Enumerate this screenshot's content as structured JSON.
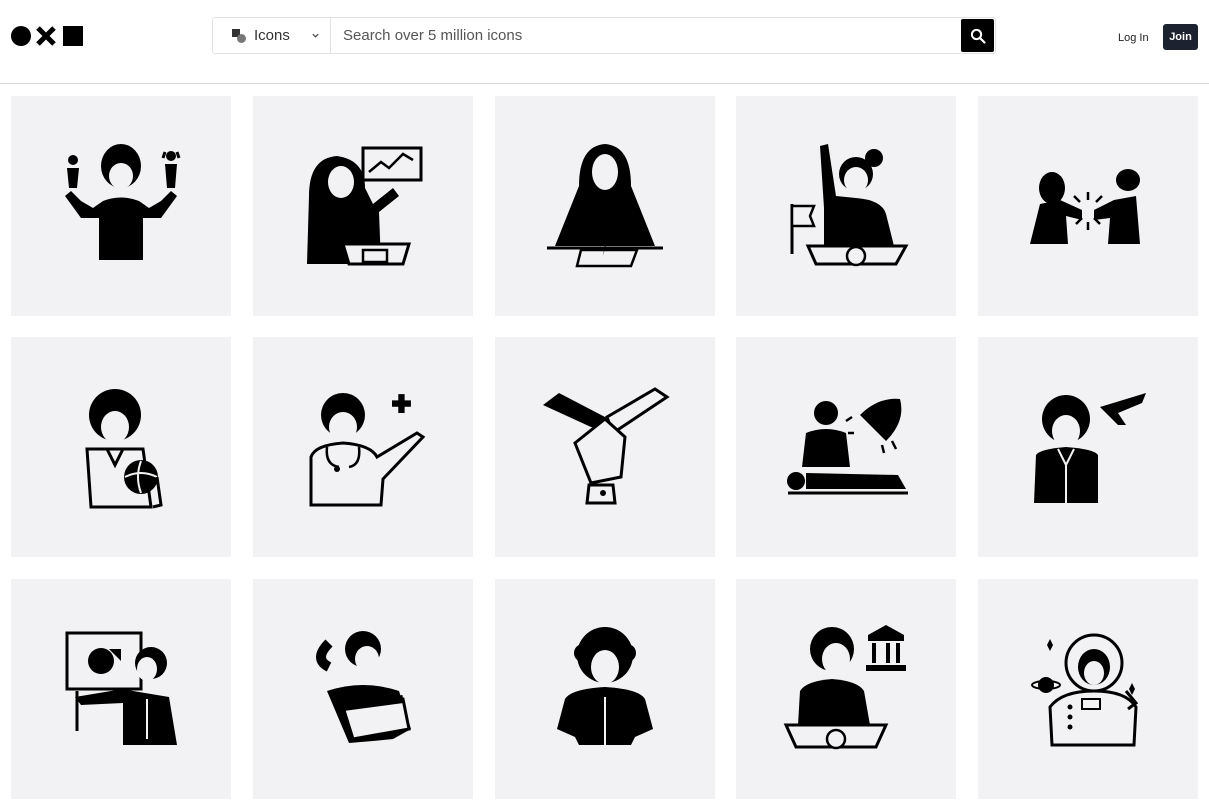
{
  "header": {
    "logo": "noun project logo",
    "search": {
      "type_label": "Icons",
      "type_icon": "icons-type-icon",
      "placeholder": "Search over 5 million icons",
      "button_icon": "search-icon"
    },
    "login_label": "Log In",
    "join_label": "Join"
  },
  "results": [
    {
      "icon": "woman-holding-figures-icon"
    },
    {
      "icon": "hijab-woman-presenting-chart-icon"
    },
    {
      "icon": "hijab-woman-writing-icon"
    },
    {
      "icon": "woman-raising-hand-podium-icon"
    },
    {
      "icon": "women-fist-bump-icon"
    },
    {
      "icon": "woman-with-volleyball-icon"
    },
    {
      "icon": "female-doctor-icon"
    },
    {
      "icon": "stacked-hands-icon"
    },
    {
      "icon": "surgeon-with-patient-icon"
    },
    {
      "icon": "female-pilot-icon"
    },
    {
      "icon": "woman-teacher-pie-chart-icon"
    },
    {
      "icon": "woman-with-clapperboard-icon"
    },
    {
      "icon": "curly-hair-woman-icon"
    },
    {
      "icon": "woman-politician-icon"
    },
    {
      "icon": "female-astronaut-icon"
    }
  ]
}
